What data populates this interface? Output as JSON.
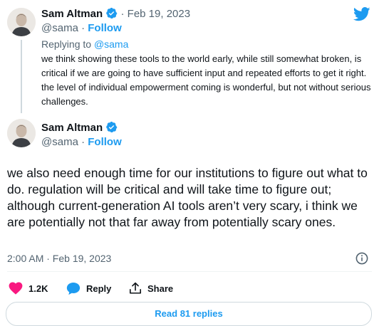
{
  "quoted": {
    "author_name": "Sam Altman",
    "date": "Feb 19, 2023",
    "handle": "@sama",
    "follow_label": "Follow",
    "replying_prefix": "Replying to",
    "replying_handle": "@sama",
    "text": "we think showing these tools to the world early, while still somewhat broken, is critical if we are going to have sufficient input and repeated efforts to get it right. the level of individual empowerment coming is wonderful, but not without serious challenges."
  },
  "main": {
    "author_name": "Sam Altman",
    "handle": "@sama",
    "follow_label": "Follow",
    "text": "we also need enough time for our institutions to figure out what to do. regulation will be critical and will take time to figure out; although current-generation AI tools aren’t very scary, i think we are potentially not that far away from potentially scary ones.",
    "timestamp": "2:00 AM · Feb 19, 2023"
  },
  "actions": {
    "like_count": "1.2K",
    "reply_label": "Reply",
    "share_label": "Share"
  },
  "read_replies_label": "Read 81 replies",
  "icons": {
    "brand": "twitter-bird-icon",
    "verified": "verified-badge-icon",
    "info": "info-icon",
    "like": "heart-icon",
    "reply": "speech-bubble-icon",
    "share": "share-upload-icon"
  },
  "colors": {
    "accent": "#1d9bf0",
    "like": "#f91880",
    "text": "#0f1419",
    "secondary": "#536471"
  }
}
